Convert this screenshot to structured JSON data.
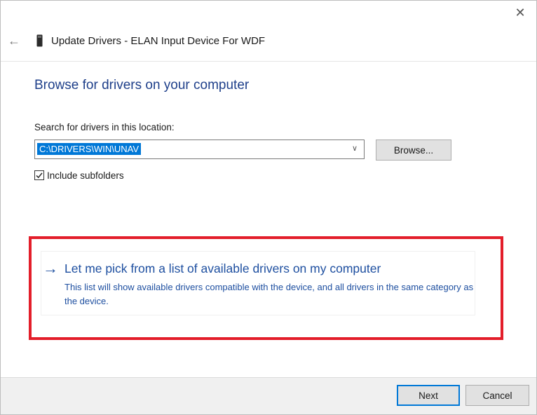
{
  "window": {
    "title": "Update Drivers - ELAN Input Device For WDF",
    "close_glyph": "✕",
    "back_glyph": "←"
  },
  "main": {
    "heading": "Browse for drivers on your computer",
    "search_label": "Search for drivers in this location:",
    "path_value": "C:\\DRIVERS\\WIN\\UNAV",
    "combo_arrow_glyph": "∨",
    "browse_label": "Browse...",
    "include_subfolders_label": "Include subfolders",
    "include_subfolders_checked": true
  },
  "pick_option": {
    "arrow_glyph": "→",
    "title": "Let me pick from a list of available drivers on my computer",
    "description": "This list will show available drivers compatible with the device, and all drivers in the same category as the device."
  },
  "footer": {
    "next_label": "Next",
    "cancel_label": "Cancel"
  },
  "colors": {
    "accent": "#0078d7",
    "link": "#1e4fa0",
    "heading": "#1e3f8a",
    "highlight": "#e31e2a"
  },
  "icons": {
    "back": "back-arrow-icon",
    "close": "close-icon",
    "device": "device-icon",
    "combo": "chevron-down-icon",
    "check": "checkmark-icon",
    "option": "arrow-right-icon"
  }
}
